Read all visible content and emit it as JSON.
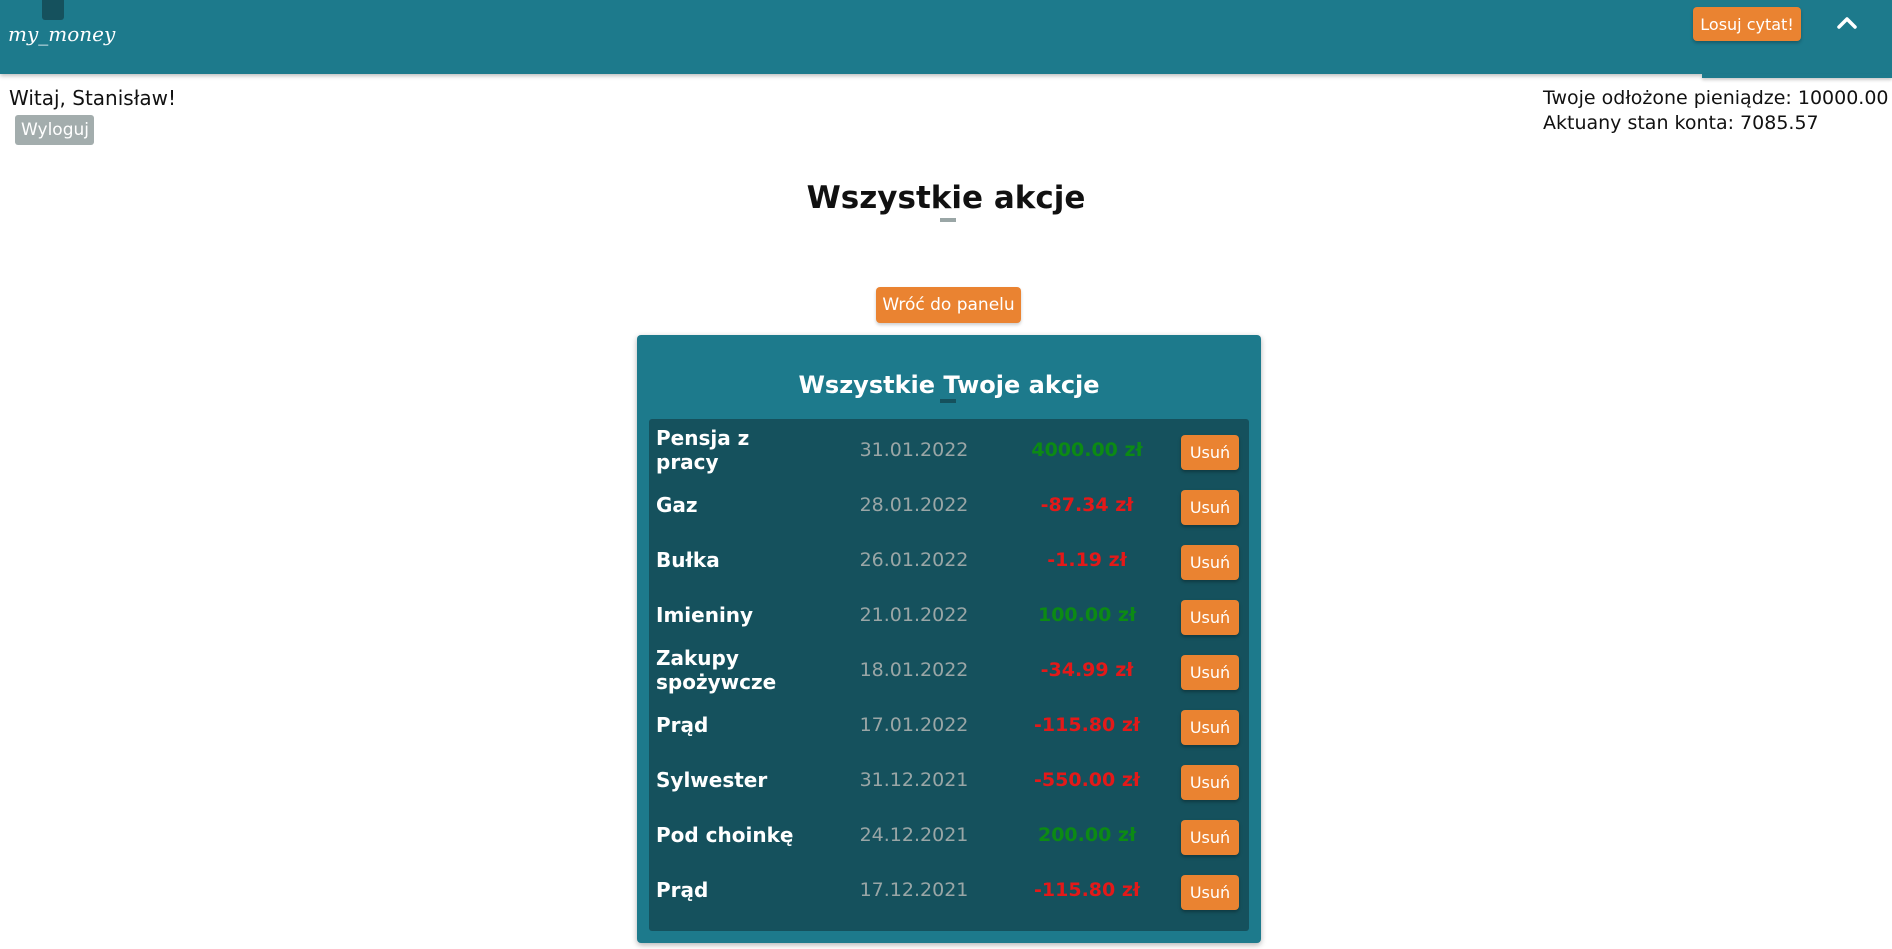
{
  "header": {
    "logo_text": "my_money",
    "logo_icon": "wallet-icon",
    "quote_button": "Losuj cytat!",
    "collapse_icon": "chevron-up-icon"
  },
  "user": {
    "greeting": "Witaj, Stanisław!",
    "logout_label": "Wyloguj",
    "savings": "Twoje odłożone pieniądze: 10000.00",
    "balance": "Aktuany stan konta: 7085.57"
  },
  "page_title": "Wszystkie akcje",
  "back_button": "Wróć do panelu",
  "card_title": "Wszystkie Twoje akcje",
  "colors": {
    "header": "#1d7a8c",
    "accent": "#ea8331",
    "table": "#15515d",
    "positive": "#0c8a14",
    "negative": "#e31919"
  },
  "actions": [
    {
      "name": "Pensja z pracy",
      "date": "31.01.2022",
      "amount": "4000.00 zł",
      "type": "pos",
      "delete": "Usuń"
    },
    {
      "name": "Gaz",
      "date": "28.01.2022",
      "amount": "-87.34 zł",
      "type": "neg",
      "delete": "Usuń"
    },
    {
      "name": "Bułka",
      "date": "26.01.2022",
      "amount": "-1.19 zł",
      "type": "neg",
      "delete": "Usuń"
    },
    {
      "name": "Imieniny",
      "date": "21.01.2022",
      "amount": "100.00 zł",
      "type": "pos",
      "delete": "Usuń"
    },
    {
      "name": "Zakupy spożywcze",
      "date": "18.01.2022",
      "amount": "-34.99 zł",
      "type": "neg",
      "delete": "Usuń"
    },
    {
      "name": "Prąd",
      "date": "17.01.2022",
      "amount": "-115.80 zł",
      "type": "neg",
      "delete": "Usuń"
    },
    {
      "name": "Sylwester",
      "date": "31.12.2021",
      "amount": "-550.00 zł",
      "type": "neg",
      "delete": "Usuń"
    },
    {
      "name": "Pod choinkę",
      "date": "24.12.2021",
      "amount": "200.00 zł",
      "type": "pos",
      "delete": "Usuń"
    },
    {
      "name": "Prąd",
      "date": "17.12.2021",
      "amount": "-115.80 zł",
      "type": "neg",
      "delete": "Usuń"
    }
  ]
}
